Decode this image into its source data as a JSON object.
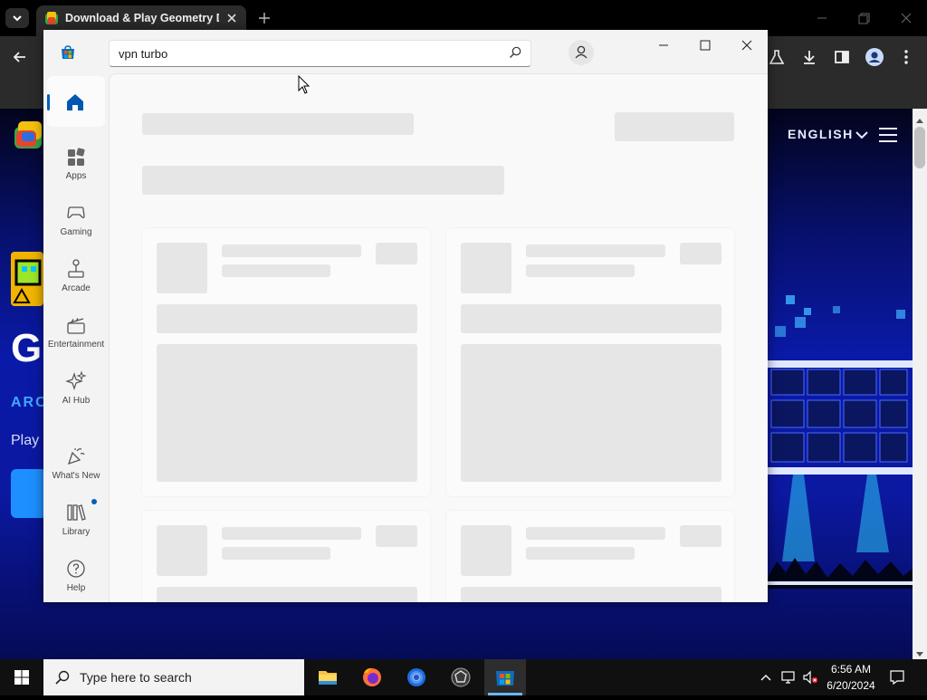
{
  "browser": {
    "tab_title": "Download & Play Geometry Dash on PC"
  },
  "website": {
    "language": "ENGLISH",
    "hero_title_partial": "G",
    "genre_partial": "ARC",
    "play_partial": "Play"
  },
  "store": {
    "search_value": "vpn turbo",
    "nav": [
      {
        "label": ""
      },
      {
        "label": "Apps"
      },
      {
        "label": "Gaming"
      },
      {
        "label": "Arcade"
      },
      {
        "label": "Entertainment"
      },
      {
        "label": "AI Hub"
      },
      {
        "label": "What's New"
      },
      {
        "label": "Library"
      },
      {
        "label": "Help"
      }
    ]
  },
  "taskbar": {
    "search_placeholder": "Type here to search",
    "time": "6:56 AM",
    "date": "6/20/2024"
  },
  "colors": {
    "accent": "#005fb8",
    "website_blue": "#0a1aa8"
  }
}
